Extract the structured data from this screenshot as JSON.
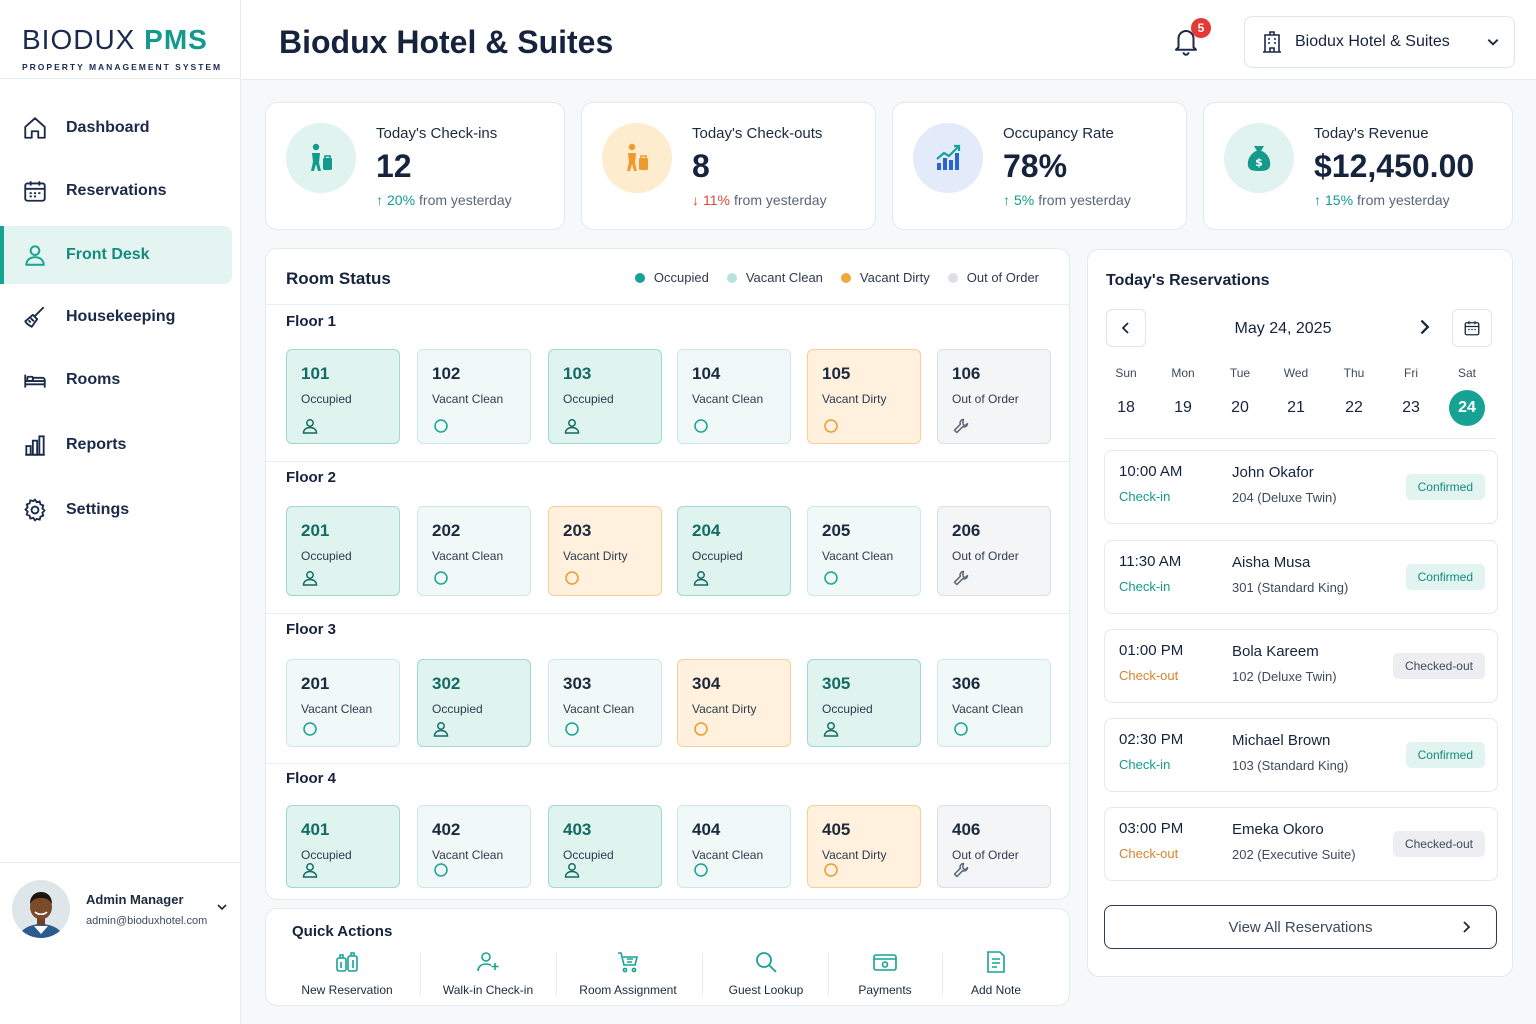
{
  "brand": {
    "logo_part1": "BIODUX",
    "logo_part2": "PMS",
    "tagline": "PROPERTY MANAGEMENT SYSTEM",
    "accent": "#16a394",
    "navy": "#16233d"
  },
  "sidebar": {
    "items": [
      {
        "label": "Dashboard",
        "icon": "home-icon"
      },
      {
        "label": "Reservations",
        "icon": "calendar-icon"
      },
      {
        "label": "Front Desk",
        "icon": "user-icon",
        "active": true
      },
      {
        "label": "Housekeeping",
        "icon": "broom-icon"
      },
      {
        "label": "Rooms",
        "icon": "bed-icon"
      },
      {
        "label": "Reports",
        "icon": "bar-chart-icon"
      },
      {
        "label": "Settings",
        "icon": "gear-icon"
      }
    ],
    "user": {
      "name": "Admin Manager",
      "email": "admin@bioduxhotel.com"
    }
  },
  "header": {
    "title": "Biodux Hotel & Suites",
    "notifications": "5",
    "hotel_select": "Biodux Hotel & Suites"
  },
  "stats": [
    {
      "label": "Today's Check-ins",
      "value": "12",
      "delta": "20%",
      "trend": "up",
      "suffix": "from yesterday",
      "icon": "person-luggage-icon"
    },
    {
      "label": "Today's Check-outs",
      "value": "8",
      "delta": "11%",
      "trend": "down",
      "suffix": "from yesterday",
      "icon": "person-luggage-icon"
    },
    {
      "label": "Occupancy Rate",
      "value": "78%",
      "delta": "5%",
      "trend": "up",
      "suffix": "from yesterday",
      "icon": "chart-up-icon"
    },
    {
      "label": "Today's Revenue",
      "value": "$12,450.00",
      "delta": "15%",
      "trend": "up",
      "suffix": "from yesterday",
      "icon": "money-bag-icon"
    }
  ],
  "room_status": {
    "title": "Room Status",
    "legend": [
      {
        "label": "Occupied",
        "color": "#16a394"
      },
      {
        "label": "Vacant Clean",
        "color": "#b8e3dc"
      },
      {
        "label": "Vacant Dirty",
        "color": "#f2a93b"
      },
      {
        "label": "Out of Order",
        "color": "#dcdfe3"
      }
    ],
    "floors": [
      {
        "label": "Floor 1",
        "rooms": [
          {
            "number": "101",
            "status": "Occupied"
          },
          {
            "number": "102",
            "status": "Vacant Clean"
          },
          {
            "number": "103",
            "status": "Occupied"
          },
          {
            "number": "104",
            "status": "Vacant Clean"
          },
          {
            "number": "105",
            "status": "Vacant Dirty"
          },
          {
            "number": "106",
            "status": "Out of Order"
          }
        ]
      },
      {
        "label": "Floor 2",
        "rooms": [
          {
            "number": "201",
            "status": "Occupied"
          },
          {
            "number": "202",
            "status": "Vacant Clean"
          },
          {
            "number": "203",
            "status": "Vacant Dirty"
          },
          {
            "number": "204",
            "status": "Occupied"
          },
          {
            "number": "205",
            "status": "Vacant Clean"
          },
          {
            "number": "206",
            "status": "Out of Order"
          }
        ]
      },
      {
        "label": "Floor 3",
        "rooms": [
          {
            "number": "201",
            "status": "Vacant Clean"
          },
          {
            "number": "302",
            "status": "Occupied"
          },
          {
            "number": "303",
            "status": "Vacant Clean"
          },
          {
            "number": "304",
            "status": "Vacant Dirty"
          },
          {
            "number": "305",
            "status": "Occupied"
          },
          {
            "number": "306",
            "status": "Vacant Clean"
          }
        ]
      },
      {
        "label": "Floor 4",
        "rooms": [
          {
            "number": "401",
            "status": "Occupied"
          },
          {
            "number": "402",
            "status": "Vacant Clean"
          },
          {
            "number": "403",
            "status": "Occupied"
          },
          {
            "number": "404",
            "status": "Vacant Clean"
          },
          {
            "number": "405",
            "status": "Vacant Dirty"
          },
          {
            "number": "406",
            "status": "Out of Order"
          }
        ]
      }
    ]
  },
  "quick_actions": {
    "title": "Quick Actions",
    "items": [
      {
        "label": "New Reservation",
        "icon": "luggage-icon"
      },
      {
        "label": "Walk-in Check-in",
        "icon": "user-plus-icon"
      },
      {
        "label": "Room Assignment",
        "icon": "cart-icon"
      },
      {
        "label": "Guest Lookup",
        "icon": "search-icon"
      },
      {
        "label": "Payments",
        "icon": "payment-card-icon"
      },
      {
        "label": "Add Note",
        "icon": "note-icon"
      }
    ]
  },
  "reservations": {
    "title": "Today's Reservations",
    "date": "May 24, 2025",
    "weekdays": [
      "Sun",
      "Mon",
      "Tue",
      "Wed",
      "Thu",
      "Fri",
      "Sat"
    ],
    "days": [
      "18",
      "19",
      "20",
      "21",
      "22",
      "23",
      "24"
    ],
    "selected_day": "24",
    "items": [
      {
        "time": "10:00 AM",
        "kind": "Check-in",
        "guest": "John Okafor",
        "room": "204 (Deluxe Twin)",
        "status": "Confirmed"
      },
      {
        "time": "11:30 AM",
        "kind": "Check-in",
        "guest": "Aisha Musa",
        "room": "301 (Standard King)",
        "status": "Confirmed"
      },
      {
        "time": "01:00 PM",
        "kind": "Check-out",
        "guest": "Bola Kareem",
        "room": "102 (Deluxe Twin)",
        "status": "Checked-out"
      },
      {
        "time": "02:30 PM",
        "kind": "Check-in",
        "guest": "Michael Brown",
        "room": "103 (Standard King)",
        "status": "Confirmed"
      },
      {
        "time": "03:00 PM",
        "kind": "Check-out",
        "guest": "Emeka Okoro",
        "room": "202 (Executive Suite)",
        "status": "Checked-out"
      }
    ],
    "view_all": "View All Reservations"
  }
}
